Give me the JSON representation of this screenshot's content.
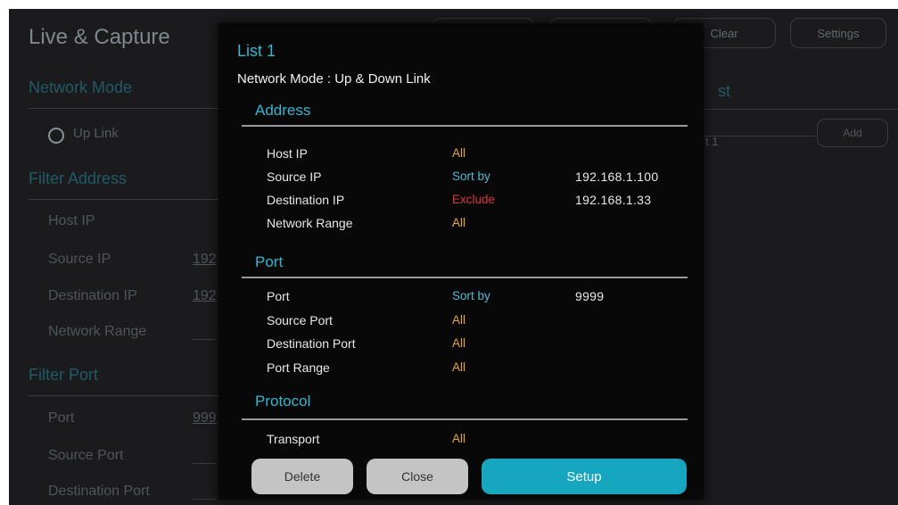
{
  "background": {
    "title": "Live & Capture",
    "top_buttons": [
      "",
      "",
      "Clear",
      "Settings"
    ],
    "network_mode": {
      "heading": "Network Mode",
      "option": "Up Link"
    },
    "filter_address": {
      "heading": "Filter Address",
      "rows": [
        {
          "label": "Host IP",
          "value": ""
        },
        {
          "label": "Source IP",
          "value": "192"
        },
        {
          "label": "Destination IP",
          "value": "192"
        },
        {
          "label": "Network Range",
          "value": ""
        }
      ]
    },
    "filter_port": {
      "heading": "Filter Port",
      "rows": [
        {
          "label": "Port",
          "value": "999"
        },
        {
          "label": "Source Port",
          "value": ""
        },
        {
          "label": "Destination Port",
          "value": ""
        }
      ]
    },
    "right_panel": {
      "heading": "st",
      "field_text": "t 1",
      "add_label": "Add"
    }
  },
  "dialog": {
    "title": "List 1",
    "subtitle": "Network Mode : Up & Down Link",
    "address": {
      "heading": "Address",
      "rows": [
        {
          "label": "Host IP",
          "mode": "All",
          "value": ""
        },
        {
          "label": "Source IP",
          "mode": "Sort by",
          "value": "192.168.1.100"
        },
        {
          "label": "Destination IP",
          "mode": "Exclude",
          "value": "192.168.1.33"
        },
        {
          "label": "Network Range",
          "mode": "All",
          "value": ""
        }
      ]
    },
    "port": {
      "heading": "Port",
      "rows": [
        {
          "label": "Port",
          "mode": "Sort by",
          "value": "9999"
        },
        {
          "label": "Source Port",
          "mode": "All",
          "value": ""
        },
        {
          "label": "Destination Port",
          "mode": "All",
          "value": ""
        },
        {
          "label": "Port Range",
          "mode": "All",
          "value": ""
        }
      ]
    },
    "protocol": {
      "heading": "Protocol",
      "rows": [
        {
          "label": "Transport",
          "mode": "All",
          "value": ""
        }
      ]
    },
    "buttons": {
      "delete": "Delete",
      "close": "Close",
      "setup": "Setup"
    }
  },
  "colors": {
    "accent": "#35b6d0",
    "all": "#e4a843",
    "sort_by": "#55b8d3",
    "exclude": "#d43a3a",
    "setup_button": "#16a6bf"
  }
}
